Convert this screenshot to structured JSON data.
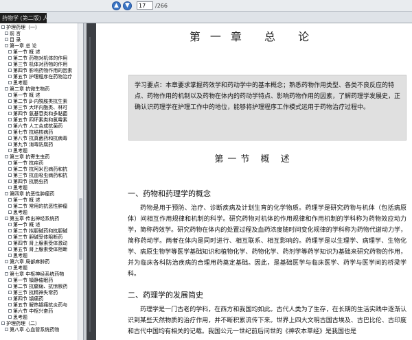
{
  "toolbar": {
    "nav_prev_label": "▲",
    "nav_next_label": "▼",
    "page_current": "17",
    "page_total": "/266"
  },
  "tab": {
    "label": "药物学 (第二版) 人民卫生",
    "close": "×"
  },
  "sidebar": {
    "items": [
      {
        "label": "护理药理（一）",
        "indent": 0
      },
      {
        "label": "前 言",
        "indent": 1
      },
      {
        "label": "目 录",
        "indent": 1
      },
      {
        "label": "第一章 总 论",
        "indent": 1
      },
      {
        "label": "第一节 概 述",
        "indent": 2
      },
      {
        "label": "第二节 药物对机体的作用",
        "indent": 2
      },
      {
        "label": "第三节 机体对药物的作用",
        "indent": 2
      },
      {
        "label": "第四节 影响药物作用的因素",
        "indent": 2
      },
      {
        "label": "第五节 护理程序在药物治疗",
        "indent": 2
      },
      {
        "label": "思考题",
        "indent": 2
      },
      {
        "label": "第二章 抗微生物药",
        "indent": 1
      },
      {
        "label": "第一节 概 述",
        "indent": 2
      },
      {
        "label": "第二节 β-内酰胺类抗生素",
        "indent": 2
      },
      {
        "label": "第三节 大环内酯类、林可",
        "indent": 2
      },
      {
        "label": "第四节 氨基苷类和多黏菌",
        "indent": 2
      },
      {
        "label": "第五节 四环素类和氯霉素",
        "indent": 2
      },
      {
        "label": "第六节 人工合成抗菌药",
        "indent": 2
      },
      {
        "label": "第七节 抗结核病药",
        "indent": 2
      },
      {
        "label": "第八节 抗真菌药和抗病毒",
        "indent": 2
      },
      {
        "label": "第九节 消毒防腐药",
        "indent": 2
      },
      {
        "label": "思考题",
        "indent": 2
      },
      {
        "label": "第三章 抗寄生虫药",
        "indent": 1
      },
      {
        "label": "第一节 抗疟药",
        "indent": 2
      },
      {
        "label": "第二节 抗阿米巴病药和抗",
        "indent": 2
      },
      {
        "label": "第三节 抗血吸虫病药和抗",
        "indent": 2
      },
      {
        "label": "第四节 抗肠虫药",
        "indent": 2
      },
      {
        "label": "思考题",
        "indent": 2
      },
      {
        "label": "第四章 抗恶性肿瘤药",
        "indent": 1
      },
      {
        "label": "第一节 概 述",
        "indent": 2
      },
      {
        "label": "第二节 常用的抗恶性肿瘤",
        "indent": 2
      },
      {
        "label": "思考题",
        "indent": 2
      },
      {
        "label": "第五章 传出神经系统药",
        "indent": 1
      },
      {
        "label": "第一节 概 述",
        "indent": 2
      },
      {
        "label": "第二节 拟胆碱药和抗胆碱",
        "indent": 2
      },
      {
        "label": "第三节 胆碱受体阻断药",
        "indent": 2
      },
      {
        "label": "第四节 肾上腺素受体激动",
        "indent": 2
      },
      {
        "label": "第五节 肾上腺素受体阻断",
        "indent": 2
      },
      {
        "label": "思考题",
        "indent": 2
      },
      {
        "label": "第六章 局部麻醉药",
        "indent": 1
      },
      {
        "label": "思考题",
        "indent": 2
      },
      {
        "label": "第七章 中枢神经系统药物",
        "indent": 1
      },
      {
        "label": "第一节 镇静催眠药",
        "indent": 2
      },
      {
        "label": "第二节 抗癫痫、抗惊厥药",
        "indent": 2
      },
      {
        "label": "第三节 抗精神失常药",
        "indent": 2
      },
      {
        "label": "第四节 镇痛药",
        "indent": 2
      },
      {
        "label": "第五节 解热镇痛抗炎药与",
        "indent": 2
      },
      {
        "label": "第六节 中枢兴奋药",
        "indent": 2
      },
      {
        "label": "思考题",
        "indent": 2
      },
      {
        "label": "护理药理（二）",
        "indent": 0
      },
      {
        "label": "第八章 心血管系统药物",
        "indent": 1
      }
    ]
  },
  "document": {
    "chapter_title": "第一章 总 论",
    "key_points": "学习要点：本章要求掌握药效学和药动学中的基本概念；熟悉药物作用类型、各类不良反应的特点、药物作用的机制以及药物在体内的药动学特点、影响药物作用的因素，了解药理学发展史，正确认识药理学在护理工作中的地位，能够将护理程序工作模式运用于药物治疗过程中。",
    "section_title": "第一节 概 述",
    "subhead_1": "一、药物和药理学的概念",
    "para_1": "药物是用于预防、治疗、诊断疾病及计划生育的化学物质。药理学是研究药物与机体（包括病原体）间相互作用规律和机制的科学。研究药物对机体的作用规律和作用机制的学科称为药物效应动力学，简称药效学。研究药物在体内的处置过程及血药浓度随时间变化规律的学科称为药物代谢动力学，简称药动学。两者在体内是同时进行、相互联系、相互影响的。药理学是以生理学、病理学、生物化学、病原生物学等医学基础知识和植物化学、药物化学、药剂学等药学知识为基础来研究药物的作用，并为临床各科防治疾病的合理用药奠定基础。因此，是基础医学与临床医学、药学与医学间的桥梁学科。",
    "subhead_2": "二、药理学的发展简史",
    "para_2": "药理学是一门古老的学科，在西方和我国均如此。古代人类为了生存，在长期的生活实践中逐渐认识到某些天然物质的治疗作用，并不断积累流传下来。世界上四大文明古国古埃及、古巴比伦、古印度和古代中国均有相关的记载。我国公元一世纪前后问世的《神农本草经》是我国也是"
  }
}
